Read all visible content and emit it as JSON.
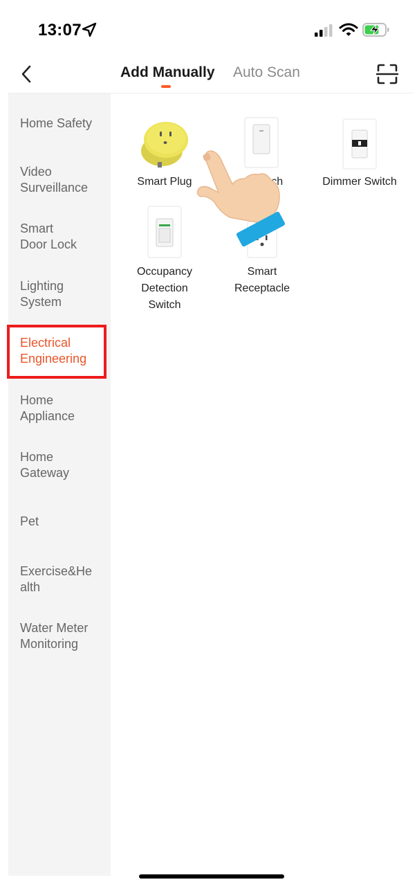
{
  "status": {
    "time": "13:07"
  },
  "header": {
    "tabs": [
      {
        "label": "Add Manually",
        "active": true
      },
      {
        "label": "Auto Scan",
        "active": false
      }
    ],
    "accent_color": "#ff5a28"
  },
  "sidebar": {
    "items": [
      {
        "label": "Home Safety"
      },
      {
        "label": "Video\nSurveillance"
      },
      {
        "label": "Smart\nDoor Lock"
      },
      {
        "label": "Lighting\nSystem"
      },
      {
        "label": "Electrical\nEngineering",
        "active": true
      },
      {
        "label": "Home\nAppliance"
      },
      {
        "label": "Home\nGateway"
      },
      {
        "label": "Pet"
      },
      {
        "label": "Exercise&He\nalth"
      },
      {
        "label": "Water Meter\nMonitoring"
      }
    ],
    "active_color": "#e8552a",
    "highlight_color": "#ee1c1c"
  },
  "devices": [
    {
      "label": "Smart Plug",
      "icon": "smart-plug-image"
    },
    {
      "label": "Switch",
      "icon": "light-switch-image"
    },
    {
      "label": "Dimmer Switch",
      "icon": "dimmer-switch-image"
    },
    {
      "label": "Occupancy\nDetection\nSwitch",
      "icon": "occupancy-switch-image"
    },
    {
      "label": "Smart\nReceptacle",
      "icon": "smart-receptacle-image"
    }
  ]
}
